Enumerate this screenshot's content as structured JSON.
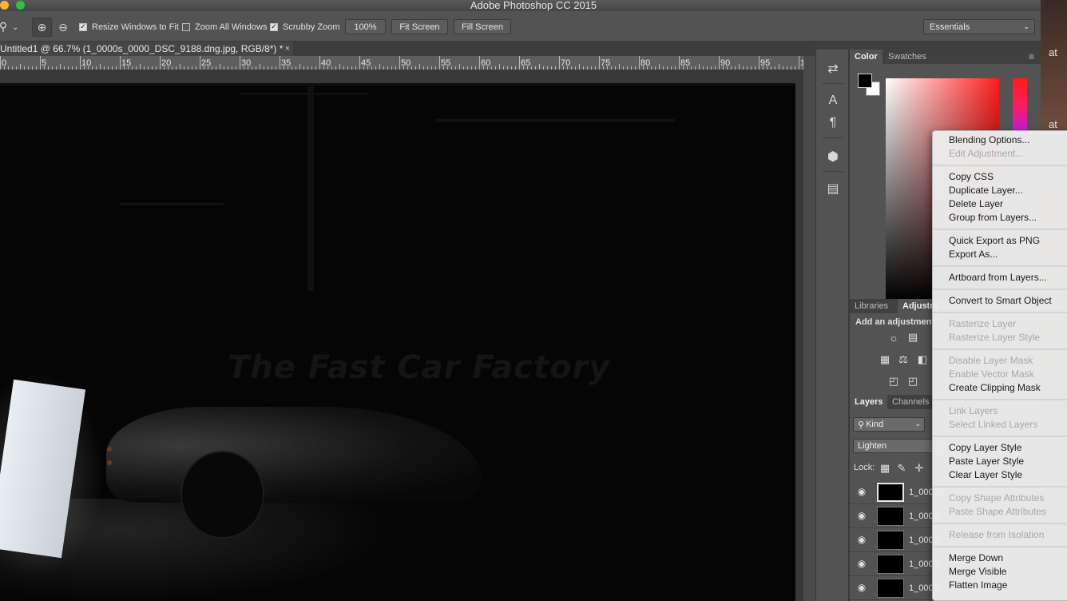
{
  "window": {
    "title": "Adobe Photoshop CC 2015"
  },
  "options_bar": {
    "resize_windows_label": "Resize Windows to Fit",
    "zoom_all_label": "Zoom All Windows",
    "scrubby_label": "Scrubby Zoom",
    "zoom_value": "100%",
    "fit_screen_label": "Fit Screen",
    "fill_screen_label": "Fill Screen",
    "workspace": "Essentials",
    "resize_windows_checked": true,
    "zoom_all_checked": false,
    "scrubby_checked": true
  },
  "document": {
    "tab_title": "Untitled1 @ 66.7% (1_0000s_0000_DSC_9188.dng.jpg, RGB/8*) *",
    "close_glyph": "×",
    "ruler_labels": [
      "0",
      "5",
      "10",
      "15",
      "20",
      "25",
      "30",
      "35",
      "40",
      "45",
      "50",
      "55",
      "60",
      "65",
      "70",
      "75",
      "80",
      "85",
      "90",
      "95",
      "1"
    ],
    "scene_text": "The Fast Car Factory"
  },
  "color_panel": {
    "tabs": [
      "Color",
      "Swatches"
    ],
    "foreground": "#000000",
    "background": "#ffffff"
  },
  "adjustments_panel": {
    "tabs": [
      "Libraries",
      "Adjustm"
    ],
    "hint": "Add an adjustment"
  },
  "layers_panel": {
    "tabs": [
      "Layers",
      "Channels"
    ],
    "filter": "Kind",
    "blend_mode": "Lighten",
    "lock_label": "Lock:",
    "layers": [
      {
        "name": "1_0000"
      },
      {
        "name": "1_0000"
      },
      {
        "name": "1_0000"
      },
      {
        "name": "1_0000"
      },
      {
        "name": "1_0000"
      }
    ]
  },
  "edge_text": [
    "at",
    "at"
  ],
  "context_menu": {
    "groups": [
      [
        {
          "label": "Blending Options...",
          "enabled": true
        },
        {
          "label": "Edit Adjustment...",
          "enabled": false
        }
      ],
      [
        {
          "label": "Copy CSS",
          "enabled": true
        },
        {
          "label": "Duplicate Layer...",
          "enabled": true
        },
        {
          "label": "Delete Layer",
          "enabled": true
        },
        {
          "label": "Group from Layers...",
          "enabled": true
        }
      ],
      [
        {
          "label": "Quick Export as PNG",
          "enabled": true
        },
        {
          "label": "Export As...",
          "enabled": true
        }
      ],
      [
        {
          "label": "Artboard from Layers...",
          "enabled": true
        }
      ],
      [
        {
          "label": "Convert to Smart Object",
          "enabled": true
        }
      ],
      [
        {
          "label": "Rasterize Layer",
          "enabled": false
        },
        {
          "label": "Rasterize Layer Style",
          "enabled": false
        }
      ],
      [
        {
          "label": "Disable Layer Mask",
          "enabled": false
        },
        {
          "label": "Enable Vector Mask",
          "enabled": false
        },
        {
          "label": "Create Clipping Mask",
          "enabled": true
        }
      ],
      [
        {
          "label": "Link Layers",
          "enabled": false
        },
        {
          "label": "Select Linked Layers",
          "enabled": false
        }
      ],
      [
        {
          "label": "Copy Layer Style",
          "enabled": true
        },
        {
          "label": "Paste Layer Style",
          "enabled": true
        },
        {
          "label": "Clear Layer Style",
          "enabled": true
        }
      ],
      [
        {
          "label": "Copy Shape Attributes",
          "enabled": false
        },
        {
          "label": "Paste Shape Attributes",
          "enabled": false
        }
      ],
      [
        {
          "label": "Release from Isolation",
          "enabled": false
        }
      ],
      [
        {
          "label": "Merge Down",
          "enabled": true
        },
        {
          "label": "Merge Visible",
          "enabled": true
        },
        {
          "label": "Flatten Image",
          "enabled": true
        }
      ]
    ]
  }
}
